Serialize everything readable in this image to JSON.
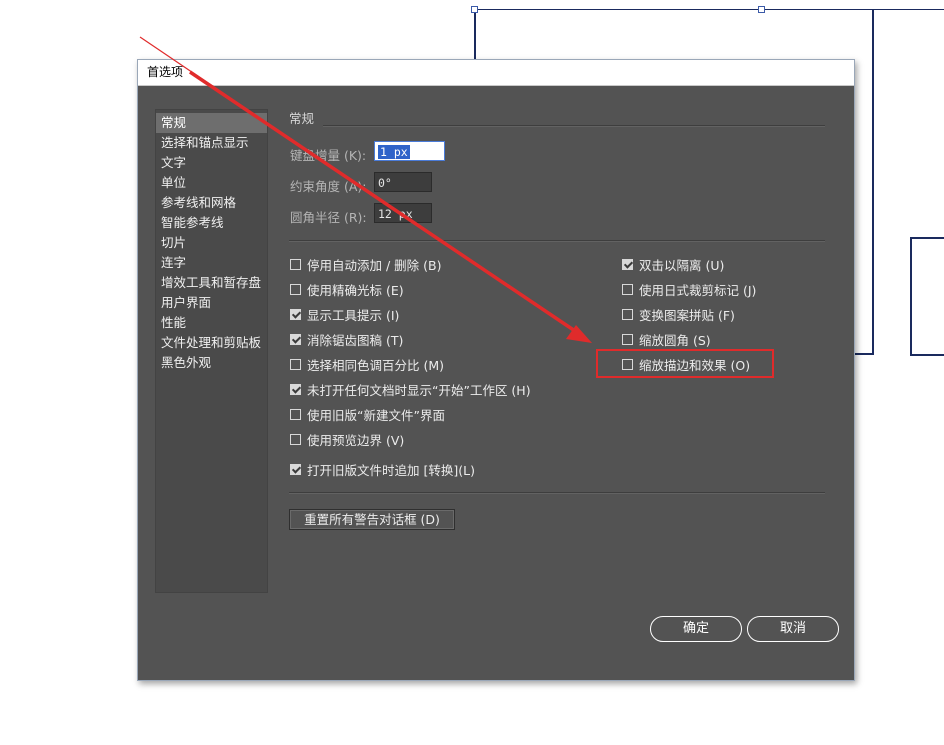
{
  "dialog": {
    "title": "首选项"
  },
  "sidebar": {
    "items": [
      {
        "label": "常规",
        "active": true
      },
      {
        "label": "选择和锚点显示",
        "active": false
      },
      {
        "label": "文字",
        "active": false
      },
      {
        "label": "单位",
        "active": false
      },
      {
        "label": "参考线和网格",
        "active": false
      },
      {
        "label": "智能参考线",
        "active": false
      },
      {
        "label": "切片",
        "active": false
      },
      {
        "label": "连字",
        "active": false
      },
      {
        "label": "增效工具和暂存盘",
        "active": false
      },
      {
        "label": "用户界面",
        "active": false
      },
      {
        "label": "性能",
        "active": false
      },
      {
        "label": "文件处理和剪贴板",
        "active": false
      },
      {
        "label": "黑色外观",
        "active": false
      }
    ]
  },
  "general": {
    "section_title": "常规",
    "keyboard_increment": {
      "label": "键盘增量 (K):",
      "value": "1 px"
    },
    "constrain_angle": {
      "label": "约束角度 (A):",
      "value": "0°"
    },
    "corner_radius": {
      "label": "圆角半径 (R):",
      "value": "12 px"
    },
    "left_options": [
      {
        "label": "停用自动添加 / 删除 (B)",
        "checked": false
      },
      {
        "label": "使用精确光标 (E)",
        "checked": false
      },
      {
        "label": "显示工具提示 (I)",
        "checked": true
      },
      {
        "label": "消除锯齿图稿 (T)",
        "checked": true
      },
      {
        "label": "选择相同色调百分比 (M)",
        "checked": false
      },
      {
        "label": "未打开任何文档时显示“开始”工作区 (H)",
        "checked": true
      },
      {
        "label": "使用旧版“新建文件”界面",
        "checked": false
      },
      {
        "label": "使用预览边界 (V)",
        "checked": false
      },
      {
        "label": "打开旧版文件时追加 [转换](L)",
        "checked": true
      }
    ],
    "right_options": [
      {
        "label": "双击以隔离 (U)",
        "checked": true
      },
      {
        "label": "使用日式裁剪标记 (J)",
        "checked": false
      },
      {
        "label": "变换图案拼贴 (F)",
        "checked": false
      },
      {
        "label": "缩放圆角 (S)",
        "checked": false
      },
      {
        "label": "缩放描边和效果 (O)",
        "checked": false
      }
    ],
    "reset_warnings_button": "重置所有警告对话框 (D)"
  },
  "footer": {
    "ok_label": "确定",
    "cancel_label": "取消"
  },
  "colors": {
    "dialog_bg": "#535353",
    "annotation_red": "#e02b2b",
    "artboard_stroke": "#1a2a5e"
  }
}
